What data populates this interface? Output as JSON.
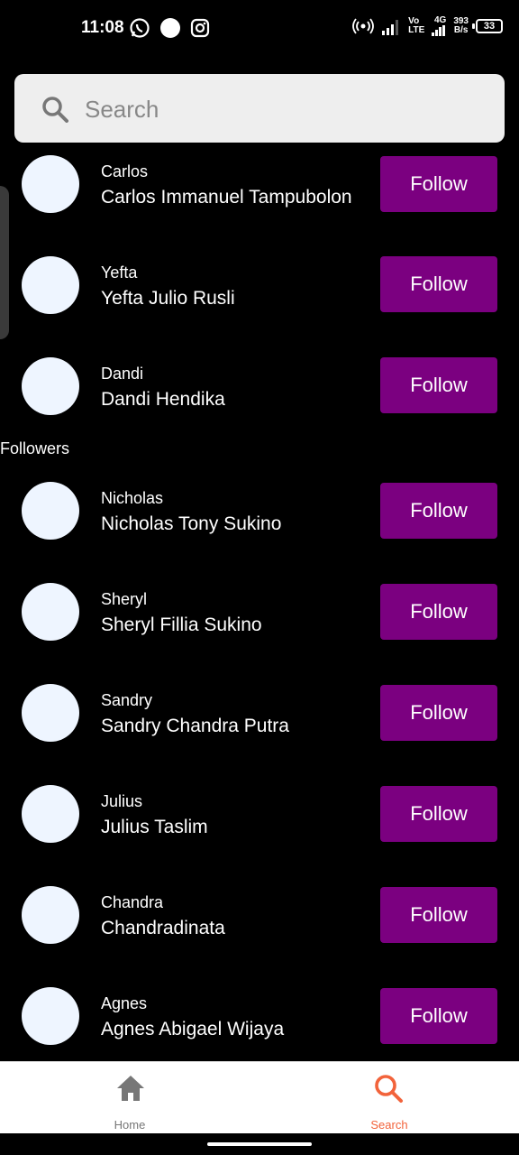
{
  "status_bar": {
    "time": "11:08",
    "net_top": "Vo",
    "net_bottom": "LTE",
    "net_gen": "4G",
    "speed_value": "393",
    "speed_unit": "B/s",
    "battery": "33"
  },
  "search": {
    "placeholder": "Search"
  },
  "following": [
    {
      "username": "Carlos",
      "name": "Carlos Immanuel Tampubolon",
      "button": "Follow"
    },
    {
      "username": "Yefta",
      "name": "Yefta Julio Rusli",
      "button": "Follow"
    },
    {
      "username": "Dandi",
      "name": "Dandi Hendika",
      "button": "Follow"
    }
  ],
  "followers_label": "Followers",
  "followers": [
    {
      "username": "Nicholas",
      "name": "Nicholas Tony Sukino",
      "button": "Follow"
    },
    {
      "username": "Sheryl",
      "name": "Sheryl Fillia Sukino",
      "button": "Follow"
    },
    {
      "username": "Sandry",
      "name": "Sandry Chandra Putra",
      "button": "Follow"
    },
    {
      "username": "Julius",
      "name": "Julius Taslim",
      "button": "Follow"
    },
    {
      "username": "Chandra",
      "name": "Chandradinata",
      "button": "Follow"
    },
    {
      "username": "Agnes",
      "name": "Agnes Abigael Wijaya",
      "button": "Follow"
    }
  ],
  "nav": {
    "home": {
      "label": "Home",
      "icon": "home-icon",
      "color": "#777777"
    },
    "search": {
      "label": "Search",
      "icon": "search-icon",
      "color": "#f2633b"
    }
  },
  "colors": {
    "follow_button": "#7b0080",
    "avatar": "#eef5ff",
    "background": "#000000"
  }
}
